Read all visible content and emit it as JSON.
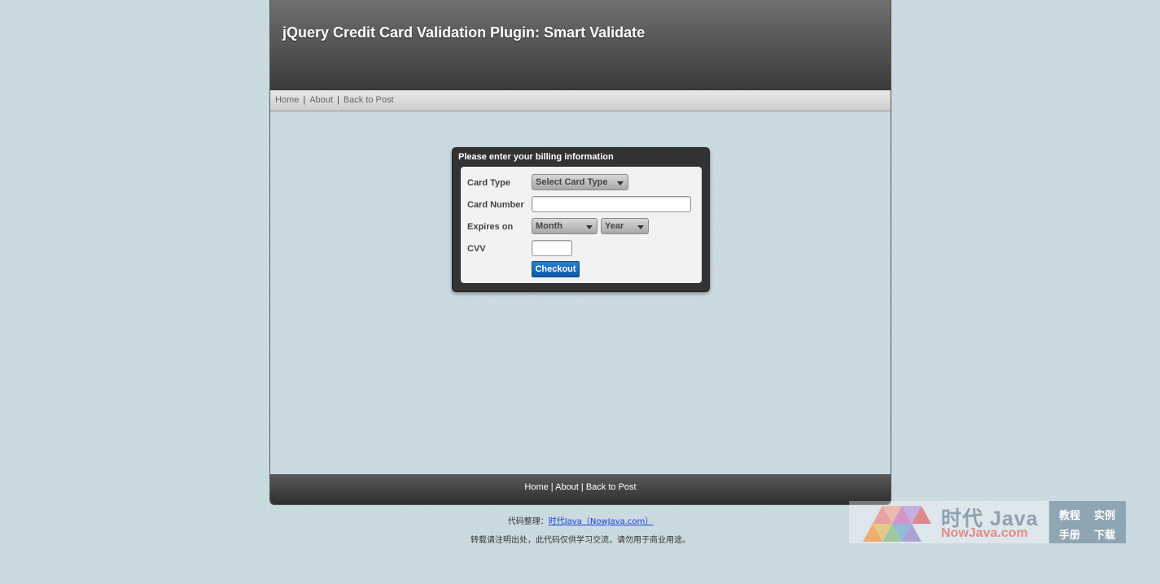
{
  "header": {
    "title": "jQuery Credit Card Validation Plugin: Smart Validate"
  },
  "top_nav": {
    "home": "Home",
    "about": "About",
    "back": "Back to Post",
    "separator": "|"
  },
  "form": {
    "title": "Please enter your billing information",
    "card_type_label": "Card Type",
    "card_type_value": "Select Card Type",
    "card_number_label": "Card Number",
    "card_number_value": "",
    "expires_label": "Expires on",
    "month_value": "Month",
    "year_value": "Year",
    "cvv_label": "CVV",
    "cvv_value": "",
    "checkout_label": "Checkout"
  },
  "footer": {
    "home": "Home",
    "about": "About",
    "back": "Back to Post",
    "separator": "|"
  },
  "credits": {
    "line1_prefix": "代码整理：",
    "line1_link": "时代Java（NowJava.com）",
    "line2": "转载请注明出处，此代码仅供学习交流，请勿用于商业用途。"
  },
  "watermark": {
    "title": "时代 Java",
    "subtitle": "NowJava.com",
    "tags": [
      "教程",
      "实例",
      "手册",
      "下载"
    ]
  }
}
